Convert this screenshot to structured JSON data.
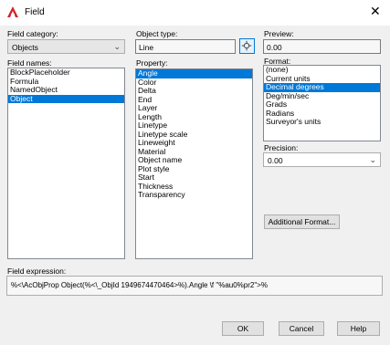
{
  "window": {
    "title": "Field",
    "close_icon": "close-icon",
    "logo_icon": "autocad-logo-icon"
  },
  "field_category": {
    "label": "Field category:",
    "value": "Objects"
  },
  "field_names": {
    "label": "Field names:",
    "items": [
      "BlockPlaceholder",
      "Formula",
      "NamedObject",
      "Object"
    ],
    "selected": "Object"
  },
  "object_type": {
    "label": "Object type:",
    "value": "Line",
    "pick_icon": "select-object-icon"
  },
  "property": {
    "label": "Property:",
    "items": [
      "Angle",
      "Color",
      "Delta",
      "End",
      "Layer",
      "Length",
      "Linetype",
      "Linetype scale",
      "Lineweight",
      "Material",
      "Object name",
      "Plot style",
      "Start",
      "Thickness",
      "Transparency"
    ],
    "selected": "Angle"
  },
  "preview": {
    "label": "Preview:",
    "value": "0.00"
  },
  "format": {
    "label": "Format:",
    "items": [
      "(none)",
      "Current units",
      "Decimal degrees",
      "Deg/min/sec",
      "Grads",
      "Radians",
      "Surveyor's units"
    ],
    "selected": "Decimal degrees"
  },
  "precision": {
    "label": "Precision:",
    "value": "0.00"
  },
  "additional_format_button": "Additional Format...",
  "field_expression": {
    "label": "Field expression:",
    "value": "%<\\AcObjProp Object(%<\\_ObjId 1949674470464>%).Angle \\f \"%au0%pr2\">%"
  },
  "buttons": {
    "ok": "OK",
    "cancel": "Cancel",
    "help": "Help"
  },
  "colors": {
    "selection": "#0078d7",
    "logo_red": "#d2232a"
  }
}
